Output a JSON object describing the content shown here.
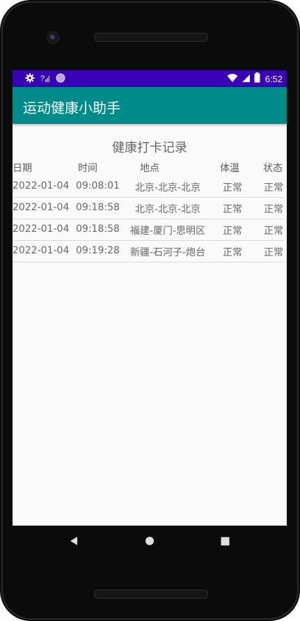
{
  "status_bar": {
    "time": "6:52",
    "icons": [
      "gear-icon",
      "no-sim-signal-icon",
      "circle-icon",
      "wifi-icon",
      "cell-signal-icon",
      "battery-icon"
    ],
    "background_color": "#3a00b5"
  },
  "app_bar": {
    "title": "运动健康小助手",
    "background_color": "#008b8b"
  },
  "main": {
    "heading": "健康打卡记录",
    "columns": [
      "日期",
      "时间",
      "地点",
      "体温",
      "状态"
    ],
    "rows": [
      {
        "date": "2022-01-04",
        "time": "09:08:01",
        "location": "北京-北京-北京",
        "temperature": "正常",
        "status": "正常"
      },
      {
        "date": "2022-01-04",
        "time": "09:18:58",
        "location": "北京-北京-北京",
        "temperature": "正常",
        "status": "正常"
      },
      {
        "date": "2022-01-04",
        "time": "09:18:58",
        "location": "福建-厦门-思明区",
        "temperature": "正常",
        "status": "正常"
      },
      {
        "date": "2022-01-04",
        "time": "09:19:28",
        "location": "新疆-石河子-炮台",
        "temperature": "正常",
        "status": "正常"
      }
    ]
  },
  "nav_bar": {
    "icons": [
      "back-triangle-icon",
      "home-circle-icon",
      "recents-square-icon"
    ]
  }
}
